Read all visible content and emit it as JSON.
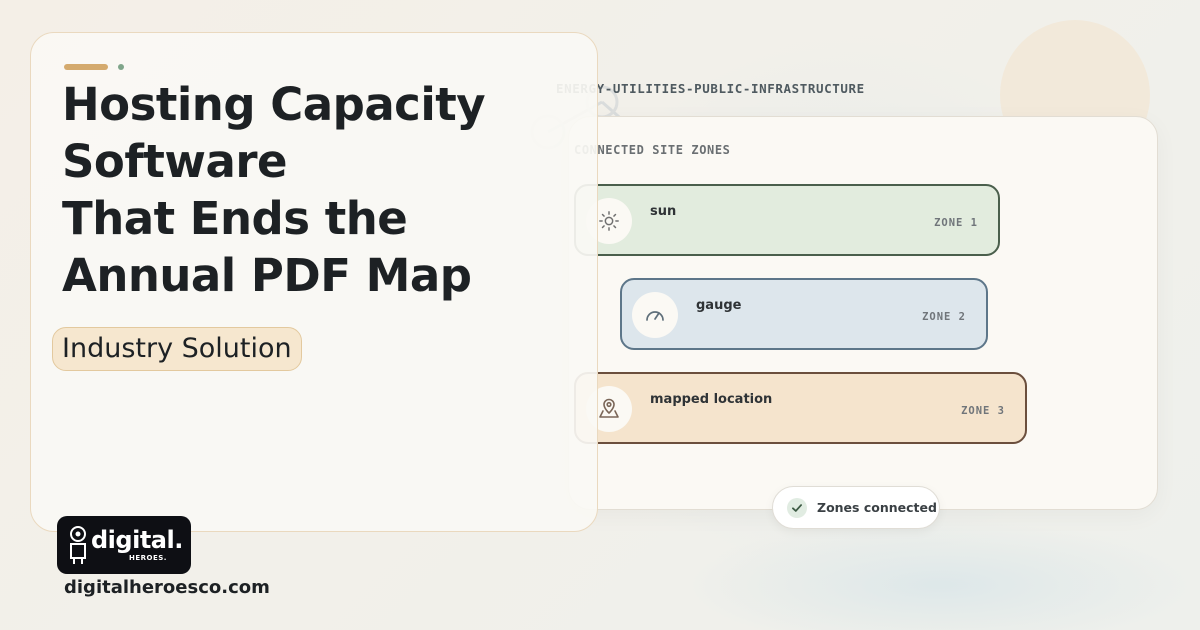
{
  "hero": {
    "headline_lines": [
      "Hosting Capacity",
      "Software",
      "That Ends the",
      "Annual PDF Map"
    ],
    "badge": "Industry Solution"
  },
  "brand": {
    "logo_word": "digital.",
    "logo_sub": "HEROES.",
    "website": "digitalheroesco.com"
  },
  "visual": {
    "industry_label": "ENERGY-UTILITIES-PUBLIC-INFRASTRUCTURE",
    "panel_title": "CONNECTED SITE ZONES",
    "zones": [
      {
        "name": "sun",
        "tag": "ZONE 1",
        "icon": "sun-icon",
        "fill": "#e2ecde",
        "border": "#4a5f4c"
      },
      {
        "name": "gauge",
        "tag": "ZONE 2",
        "icon": "gauge-icon",
        "fill": "#dde6ec",
        "border": "#5d7689"
      },
      {
        "name": "mapped location",
        "tag": "ZONE 3",
        "icon": "map-pin-icon",
        "fill": "#f5e4cd",
        "border": "#6b4f3d"
      }
    ],
    "status": {
      "text": "Zones connected",
      "icon": "check-icon"
    }
  },
  "colors": {
    "accent_gold": "#d4aa6e",
    "accent_green": "#7fa58a",
    "badge_fill": "#f6e7cf",
    "text_dark": "#1d2124"
  }
}
